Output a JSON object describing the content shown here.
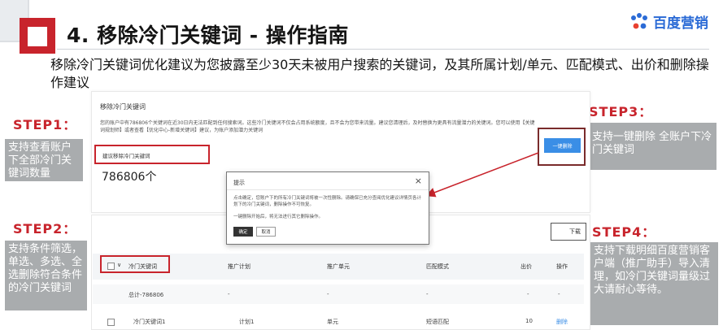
{
  "header": {
    "title": "4. 移除冷门关键词 - 操作指南",
    "logo_text": "百度营销",
    "subtitle": "移除冷门关键词优化建议为您披露至少30天未被用户搜索的关键词，及其所属计划/单元、匹配模式、出价和删除操作建议"
  },
  "steps": {
    "step1": {
      "label": "STEP1：",
      "desc": "支持查看账户下全部冷门关键词数量"
    },
    "step2": {
      "label": "STEP2：",
      "desc": "支持条件筛选，单选、多选、全选删除符合条件的冷门关键词"
    },
    "step3": {
      "label": "STEP3：",
      "desc": "支持一键删除 全账户下冷门关键词"
    },
    "step4": {
      "label": "STEP4：",
      "desc": "支持下载明细百度营销客户端（推广助手）导入清理，如冷门关键词量级过大请耐心等待。"
    }
  },
  "panel": {
    "title": "移除冷门关键词",
    "desc": "您的账户中有786806个关键词在近30日内无法匹配到任何搜索词。这些冷门关键词不仅会占用系统额度，且不会为您带来流量。建议您清理后，及时替换为更具有流量潜力的关键词。您可以使用【关键词规划师】或者查看【优化中心-新增关键词】建议，为账户添加潜力关键词",
    "suggest_label": "建议移除冷门关键词",
    "count": "786806个",
    "one_click_delete": "一键删除",
    "download": "下载"
  },
  "dialog": {
    "title": "提示",
    "close": "×",
    "text1": "点击确定，您账户下的所有冷门关键词将被一次性删除。请确保已充分查阅优化建议详情页各计划下的冷门关键词，删除操作不可恢复。",
    "text2": "一键删除开始后，将无法进行其它删除操作。",
    "confirm": "确定",
    "cancel": "取消"
  },
  "table": {
    "columns": [
      "冷门关键词",
      "推广计划",
      "推广单元",
      "匹配模式",
      "出价",
      "操作"
    ],
    "total_row": [
      "总计-786806",
      "-",
      "-",
      "-",
      "-",
      "-"
    ],
    "rows": [
      [
        "冷门关键词1",
        "计划1",
        "单元",
        "短语匹配",
        "10",
        "删除"
      ]
    ]
  },
  "colors": {
    "accent": "#c8242c",
    "blue": "#3a8ee6",
    "box_grey": "#a9acae"
  }
}
